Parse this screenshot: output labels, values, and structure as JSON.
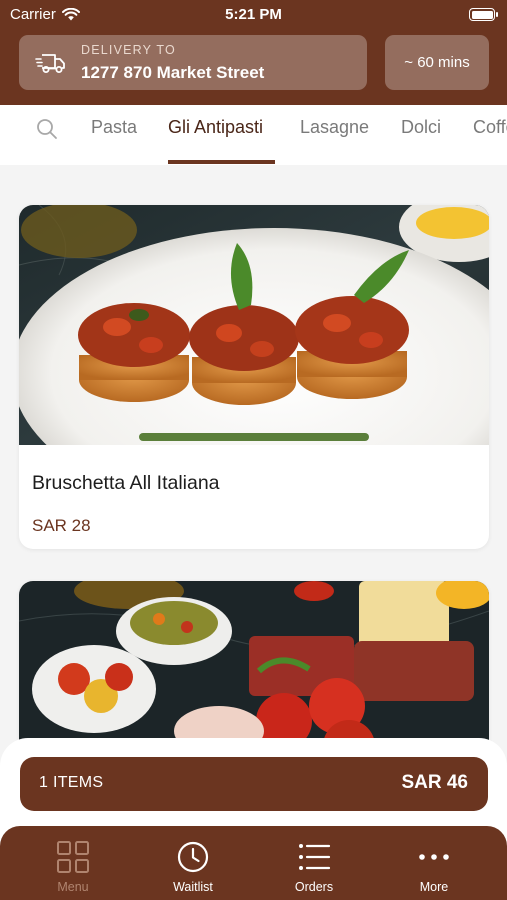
{
  "status_bar": {
    "carrier": "Carrier",
    "time": "5:21 PM"
  },
  "header": {
    "delivery_label": "DELIVERY TO",
    "delivery_address": "1277 870 Market Street",
    "eta": "~ 60 mins"
  },
  "categories": {
    "active_index": 1,
    "items": [
      "Pasta",
      "Gli Antipasti",
      "Lasagne",
      "Dolci",
      "Coffee"
    ]
  },
  "products": [
    {
      "name": "Bruschetta All Italiana",
      "price": "SAR 28"
    },
    {
      "name": "",
      "price": ""
    }
  ],
  "cart": {
    "items_label": "1 ITEMS",
    "total": "SAR 46"
  },
  "tabbar": {
    "active_index": 0,
    "items": [
      {
        "label": "Menu",
        "icon": "grid-icon"
      },
      {
        "label": "Waitlist",
        "icon": "clock-icon"
      },
      {
        "label": "Orders",
        "icon": "list-icon"
      },
      {
        "label": "More",
        "icon": "ellipsis-icon"
      }
    ]
  },
  "colors": {
    "brand": "#6b3520",
    "active_tab_text": "#b0846f",
    "background": "#f4f4f4"
  }
}
